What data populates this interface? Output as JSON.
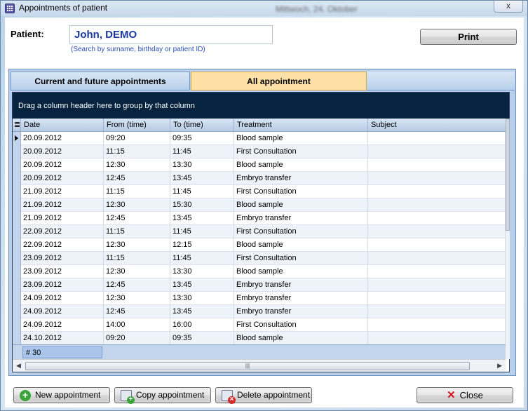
{
  "window": {
    "title": "Appointments of patient",
    "blurred_date": "Mittwoch, 24. Oktober",
    "close_glyph": "x"
  },
  "patient": {
    "label": "Patient:",
    "value": "John, DEMO",
    "hint": "(Search by surname, birthday or patient ID)"
  },
  "print_label": "Print",
  "tabs": [
    {
      "label": "Current and future appointments",
      "active": false
    },
    {
      "label": "All appointment",
      "active": true
    }
  ],
  "grid": {
    "group_hint": "Drag a column header here to group by that column",
    "columns": [
      "Date",
      "From (time)",
      "To (time)",
      "Treatment",
      "Subject"
    ],
    "rows": [
      [
        "20.09.2012",
        "09:20",
        "09:35",
        "Blood sample",
        ""
      ],
      [
        "20.09.2012",
        "11:15",
        "11:45",
        "First Consultation",
        ""
      ],
      [
        "20.09.2012",
        "12:30",
        "13:30",
        "Blood sample",
        ""
      ],
      [
        "20.09.2012",
        "12:45",
        "13:45",
        "Embryo transfer",
        ""
      ],
      [
        "21.09.2012",
        "11:15",
        "11:45",
        "First Consultation",
        ""
      ],
      [
        "21.09.2012",
        "12:30",
        "15:30",
        "Blood sample",
        ""
      ],
      [
        "21.09.2012",
        "12:45",
        "13:45",
        "Embryo transfer",
        ""
      ],
      [
        "22.09.2012",
        "11:15",
        "11:45",
        "First Consultation",
        ""
      ],
      [
        "22.09.2012",
        "12:30",
        "12:15",
        "Blood sample",
        ""
      ],
      [
        "23.09.2012",
        "11:15",
        "11:45",
        "First Consultation",
        ""
      ],
      [
        "23.09.2012",
        "12:30",
        "13:30",
        "Blood sample",
        ""
      ],
      [
        "23.09.2012",
        "12:45",
        "13:45",
        "Embryo transfer",
        ""
      ],
      [
        "24.09.2012",
        "12:30",
        "13:30",
        "Embryo transfer",
        ""
      ],
      [
        "24.09.2012",
        "12:45",
        "13:45",
        "Embryo transfer",
        ""
      ],
      [
        "24.09.2012",
        "14:00",
        "16:00",
        "First Consultation",
        ""
      ],
      [
        "24.10.2012",
        "09:20",
        "09:35",
        "Blood sample",
        ""
      ]
    ],
    "count": "# 30"
  },
  "buttons": {
    "new": "New appointment",
    "copy": "Copy appointment",
    "delete": "Delete appointment",
    "close": "Close"
  }
}
